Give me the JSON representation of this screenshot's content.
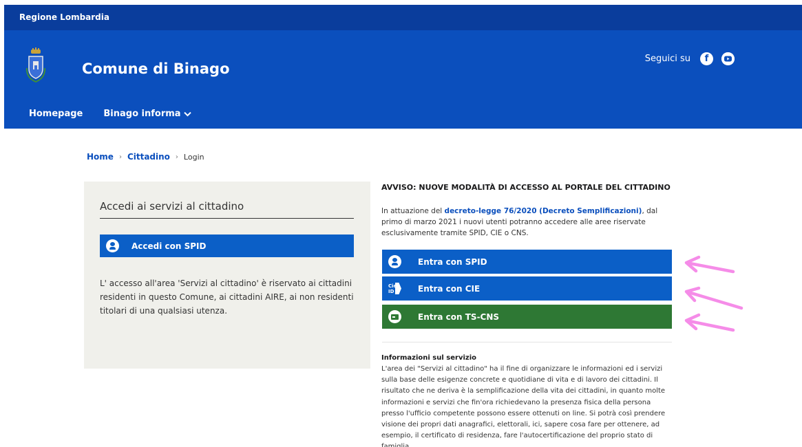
{
  "topbar": {
    "region": "Regione Lombardia"
  },
  "header": {
    "title": "Comune di Binago",
    "follow_label": "Seguici su",
    "social": [
      "facebook-icon",
      "youtube-icon"
    ],
    "nav": [
      {
        "label": "Homepage"
      },
      {
        "label": "Binago informa"
      }
    ]
  },
  "breadcrumb": {
    "home": "Home",
    "section": "Cittadino",
    "current": "Login"
  },
  "left_panel": {
    "title": "Accedi ai servizi al cittadino",
    "spid_button": "Accedi con SPID",
    "description": "L' accesso all'area 'Servizi al cittadino' è riservato ai cittadini residenti in questo Comune, ai cittadini AIRE, ai non residenti titolari di una qualsiasi utenza."
  },
  "notice": {
    "title": "AVVISO: NUOVE MODALITÀ DI ACCESSO AL PORTALE DEL CITTADINO",
    "text_before": "In attuazione del ",
    "link": "decreto-legge 76/2020 (Decreto Semplificazioni)",
    "text_after": ", dal primo di marzo 2021 i nuovi utenti potranno accedere alle aree riservate esclusivamente tramite SPID, CIE o CNS."
  },
  "auth_buttons": {
    "spid": "Entra con SPID",
    "cie": "Entra con CIE",
    "cie_icon_top": "Cie",
    "cie_icon_bottom": "ID",
    "cns": "Entra con TS-CNS"
  },
  "info": {
    "title": "Informazioni sul servizio",
    "text": "L'area dei \"Servizi al cittadino\" ha il fine di organizzare le informazioni ed i servizi sulla base delle esigenze concrete e quotidiane di vita e di lavoro dei cittadini. Il risultato che ne deriva è la semplificazione della vita dei cittadini, in quanto molte informazioni e servizi che fin'ora richiedevano la presenza fisica della persona presso l'ufficio competente possono essere ottenuti on line. Si potrà così prendere visione dei propri dati anagrafici, elettorali, ici, sapere cosa fare per ottenere, ad esempio, il certificato di residenza, fare l'autocertificazione del proprio stato di famiglia..."
  },
  "colors": {
    "topbar": "#0a3d9c",
    "header": "#0b4fbd",
    "button_blue": "#0b5fc7",
    "button_green": "#2e7834",
    "panel_bg": "#f0f0eb",
    "annotation_arrow": "#f58ce8"
  }
}
